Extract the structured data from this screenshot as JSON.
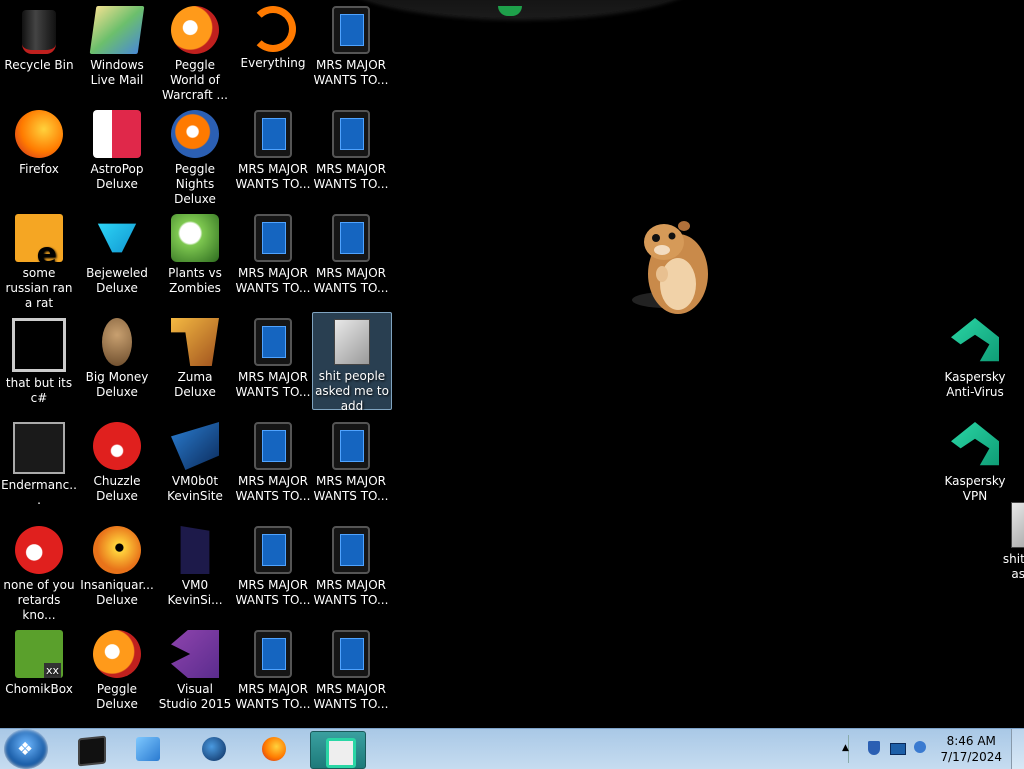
{
  "desktop": {
    "icons": [
      {
        "id": "recycle-bin",
        "label": "Recycle Bin",
        "glyph": "g-bin"
      },
      {
        "id": "windows-live-mail",
        "label": "Windows Live Mail",
        "glyph": "g-wlm"
      },
      {
        "id": "peggle-world-of-warcraft",
        "label": "Peggle World of Warcraft ...",
        "glyph": "g-peggle"
      },
      {
        "id": "everything",
        "label": "Everything",
        "glyph": "g-everything"
      },
      {
        "id": "mrs-major-1",
        "label": "MRS MAJOR WANTS TO...",
        "glyph": "g-tablet"
      },
      {
        "id": "firefox",
        "label": "Firefox",
        "glyph": "g-firefox"
      },
      {
        "id": "astropop-deluxe",
        "label": "AstroPop Deluxe",
        "glyph": "g-astropop"
      },
      {
        "id": "peggle-nights-deluxe",
        "label": "Peggle Nights Deluxe",
        "glyph": "g-nights"
      },
      {
        "id": "mrs-major-2",
        "label": "MRS MAJOR WANTS TO...",
        "glyph": "g-tablet"
      },
      {
        "id": "mrs-major-3",
        "label": "MRS MAJOR WANTS TO...",
        "glyph": "g-tablet"
      },
      {
        "id": "some-russian-ran-a-rat",
        "label": "some russian ran a rat",
        "glyph": "g-rat"
      },
      {
        "id": "bejeweled-deluxe",
        "label": "Bejeweled Deluxe",
        "glyph": "g-bejeweled"
      },
      {
        "id": "plants-vs-zombies",
        "label": "Plants vs Zombies",
        "glyph": "g-pvz"
      },
      {
        "id": "mrs-major-4",
        "label": "MRS MAJOR WANTS TO...",
        "glyph": "g-tablet"
      },
      {
        "id": "mrs-major-5",
        "label": "MRS MAJOR WANTS TO...",
        "glyph": "g-tablet"
      },
      {
        "id": "that-but-its-csharp",
        "label": "that but its c#",
        "glyph": "g-windows"
      },
      {
        "id": "big-money-deluxe",
        "label": "Big Money Deluxe",
        "glyph": "g-money"
      },
      {
        "id": "zuma-deluxe",
        "label": "Zuma Deluxe",
        "glyph": "g-zuma"
      },
      {
        "id": "mrs-major-6",
        "label": "MRS MAJOR WANTS TO...",
        "glyph": "g-tablet"
      },
      {
        "id": "shit-people-asked-me-to-add",
        "label": "shit people asked me to add",
        "glyph": "g-folder",
        "selected": true
      },
      {
        "id": "endermanch",
        "label": "Endermanc...",
        "glyph": "g-ender"
      },
      {
        "id": "chuzzle-deluxe",
        "label": "Chuzzle Deluxe",
        "glyph": "g-chuzzle"
      },
      {
        "id": "vm0b0t-kevinsite",
        "label": "VM0b0t KevinSite",
        "glyph": "g-vm"
      },
      {
        "id": "mrs-major-7",
        "label": "MRS MAJOR WANTS TO...",
        "glyph": "g-tablet"
      },
      {
        "id": "mrs-major-8",
        "label": "MRS MAJOR WANTS TO...",
        "glyph": "g-tablet"
      },
      {
        "id": "none-of-you-retards-kno",
        "label": "none of you retards kno...",
        "glyph": "g-none"
      },
      {
        "id": "insaniquarium-deluxe",
        "label": "Insaniquar... Deluxe",
        "glyph": "g-insaniquarium"
      },
      {
        "id": "vm0-kevinsite",
        "label": "VM0 KevinSi...",
        "glyph": "g-vm0"
      },
      {
        "id": "mrs-major-9",
        "label": "MRS MAJOR WANTS TO...",
        "glyph": "g-tablet"
      },
      {
        "id": "mrs-major-10",
        "label": "MRS MAJOR WANTS TO...",
        "glyph": "g-tablet"
      },
      {
        "id": "chomikbox",
        "label": "ChomikBox",
        "glyph": "g-chomik"
      },
      {
        "id": "peggle-deluxe",
        "label": "Peggle Deluxe",
        "glyph": "g-peggle"
      },
      {
        "id": "visual-studio-2015",
        "label": "Visual Studio 2015",
        "glyph": "g-vs"
      },
      {
        "id": "mrs-major-11",
        "label": "MRS MAJOR WANTS TO...",
        "glyph": "g-tablet"
      },
      {
        "id": "mrs-major-12",
        "label": "MRS MAJOR WANTS TO...",
        "glyph": "g-tablet"
      }
    ],
    "right_icons": [
      {
        "id": "kaspersky-anti-virus",
        "label": "Kaspersky Anti-Virus",
        "glyph": "g-kasp"
      },
      {
        "id": "kaspersky-vpn",
        "label": "Kaspersky VPN",
        "glyph": "g-kasp"
      },
      {
        "id": "shit-people-asked-partial",
        "label": "shit pe... asked",
        "glyph": "g-folder"
      }
    ],
    "pet": "hamster"
  },
  "taskbar": {
    "start_label": "Start",
    "pinned": [
      {
        "id": "pinned-tablet",
        "icon": "tablet-icon"
      },
      {
        "id": "pinned-media-player",
        "icon": "media-player-icon"
      },
      {
        "id": "pinned-globe",
        "icon": "globe-icon"
      },
      {
        "id": "pinned-firefox",
        "icon": "firefox-icon"
      },
      {
        "id": "pinned-kaspersky",
        "icon": "kaspersky-icon",
        "active": true
      }
    ],
    "tray": {
      "time": "8:46 AM",
      "date": "7/17/2024"
    }
  }
}
